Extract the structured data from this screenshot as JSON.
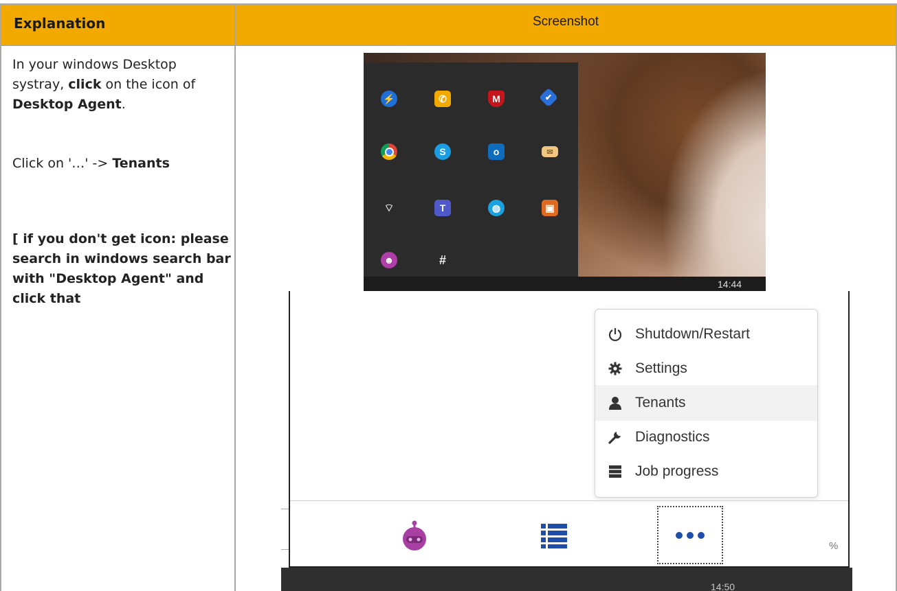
{
  "table": {
    "header_left": "Explanation",
    "header_right": "Screenshot"
  },
  "explanation": {
    "p1_a": "In your windows Desktop systray, ",
    "p1_click": "click",
    "p1_b": " on the icon of ",
    "p1_agent": "Desktop Agent",
    "p1_c": ".",
    "p2_a": "Click on '…' -> ",
    "p2_tenants": "Tenants",
    "p3": "[ if you don't get icon: please search in windows search bar with \"Desktop Agent\" and click that"
  },
  "systray": {
    "clock": "14:44",
    "icons": [
      "power-automate-icon",
      "phone-icon",
      "mcafee-icon",
      "tick-app-icon",
      "chrome-icon",
      "skype-icon",
      "outlook-icon",
      "mail-icon",
      "wifi-icon",
      "teams-icon",
      "globe-icon",
      "remote-desktop-icon",
      "desktop-agent-icon",
      "slack-icon"
    ]
  },
  "agent": {
    "menu": [
      {
        "label": "Shutdown/Restart",
        "icon": "power-icon"
      },
      {
        "label": "Settings",
        "icon": "gear-icon"
      },
      {
        "label": "Tenants",
        "icon": "user-icon"
      },
      {
        "label": "Diagnostics",
        "icon": "wrench-icon"
      },
      {
        "label": "Job progress",
        "icon": "server-icon"
      }
    ],
    "active_item": "Tenants",
    "percent_fragment": "%",
    "clock_fragment": "14:50"
  },
  "colors": {
    "header_bg": "#f2a900",
    "agent_purple": "#a83fa3",
    "list_blue": "#1f4ea8"
  }
}
